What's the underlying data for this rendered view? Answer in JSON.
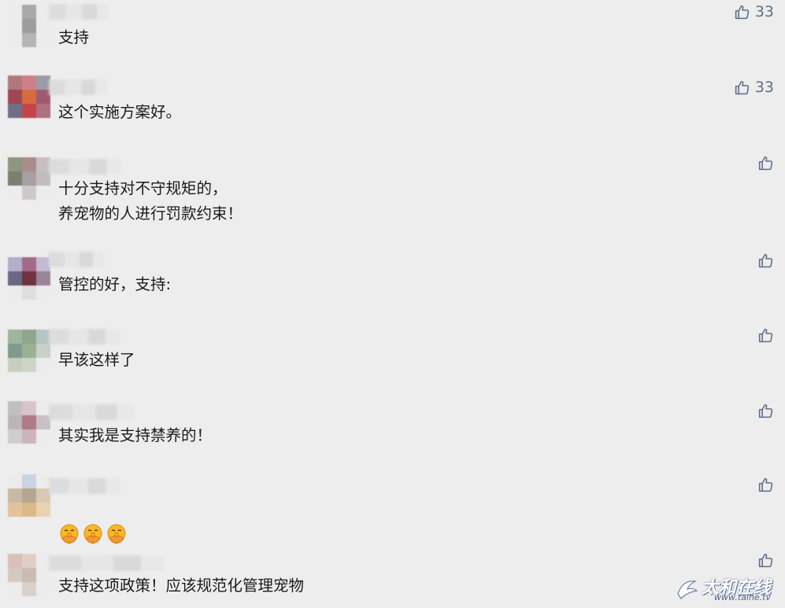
{
  "comments": [
    {
      "text": "支持",
      "likes": "33"
    },
    {
      "text": "这个实施方案好。",
      "likes": "33"
    },
    {
      "text": "十分支持对不守规矩的，\n养宠物的人进行罚款约束！",
      "likes": ""
    },
    {
      "text": "管控的好，支持:",
      "likes": ""
    },
    {
      "text": "早该这样了",
      "likes": ""
    },
    {
      "text": "其实我是支持禁养的！",
      "likes": ""
    },
    {
      "text": "",
      "likes": "",
      "emojis": [
        "shushing-face-emoji",
        "shushing-face-emoji",
        "shushing-face-emoji"
      ]
    },
    {
      "text": "支持这项政策！应该规范化管理宠物",
      "likes": ""
    }
  ],
  "watermark": {
    "main": "太和在线",
    "url": "www.taihe.tv"
  },
  "icons": {
    "like": "thumbs-up-icon"
  },
  "colors": {
    "background": "#ededed",
    "like_icon": "#5e6e8a",
    "text": "#1a1a1a"
  }
}
